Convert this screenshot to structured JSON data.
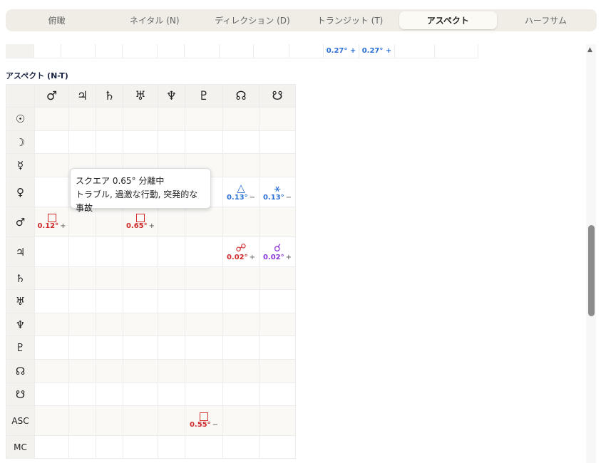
{
  "tabs": [
    {
      "label": "俯瞰",
      "active": false
    },
    {
      "label": "ネイタル (N)",
      "active": false
    },
    {
      "label": "ディレクション (D)",
      "active": false
    },
    {
      "label": "トランジット (T)",
      "active": false
    },
    {
      "label": "アスペクト",
      "active": true
    },
    {
      "label": "ハーフサム",
      "active": false
    }
  ],
  "top_row": {
    "cells": [
      "0.27° +",
      "0.27° +"
    ]
  },
  "section_title": "アスペクト (N-T)",
  "columns": [
    "♂",
    "♃",
    "♄",
    "♅",
    "♆",
    "♇",
    "☊",
    "☋"
  ],
  "rows": [
    {
      "label": "☉",
      "cells": [
        null,
        null,
        null,
        null,
        null,
        null,
        null,
        null
      ]
    },
    {
      "label": "☽",
      "cells": [
        null,
        null,
        null,
        null,
        null,
        null,
        null,
        null
      ]
    },
    {
      "label": "☿",
      "cells": [
        null,
        null,
        null,
        null,
        null,
        null,
        null,
        null
      ]
    },
    {
      "label": "♀",
      "cells": [
        null,
        null,
        null,
        null,
        null,
        null,
        {
          "symbol": "△",
          "value": "0.13°",
          "sign": "−",
          "color": "#2a6fd3",
          "name": "trine-icon"
        },
        {
          "symbol": "⚹",
          "value": "0.13°",
          "sign": "−",
          "color": "#2a6fd3",
          "name": "sextile-icon"
        }
      ]
    },
    {
      "label": "♂",
      "cells": [
        {
          "symbol": "□",
          "value": "0.12°",
          "sign": "+",
          "color": "#d02a2a",
          "name": "square-icon"
        },
        null,
        null,
        {
          "symbol": "□",
          "value": "0.65°",
          "sign": "+",
          "color": "#d02a2a",
          "name": "square-icon"
        },
        null,
        null,
        null,
        null
      ]
    },
    {
      "label": "♃",
      "cells": [
        null,
        null,
        null,
        null,
        null,
        null,
        {
          "symbol": "☍",
          "value": "0.02°",
          "sign": "+",
          "color": "#d02a2a",
          "name": "opposition-icon"
        },
        {
          "symbol": "☌",
          "value": "0.02°",
          "sign": "+",
          "color": "#8a35d8",
          "name": "conjunction-icon"
        }
      ]
    },
    {
      "label": "♄",
      "cells": [
        null,
        null,
        null,
        null,
        null,
        null,
        null,
        null
      ]
    },
    {
      "label": "♅",
      "cells": [
        null,
        null,
        null,
        null,
        null,
        null,
        null,
        null
      ]
    },
    {
      "label": "♆",
      "cells": [
        null,
        null,
        null,
        null,
        null,
        null,
        null,
        null
      ]
    },
    {
      "label": "♇",
      "cells": [
        null,
        null,
        null,
        null,
        null,
        null,
        null,
        null
      ]
    },
    {
      "label": "☊",
      "cells": [
        null,
        null,
        null,
        null,
        null,
        null,
        null,
        null
      ]
    },
    {
      "label": "☋",
      "cells": [
        null,
        null,
        null,
        null,
        null,
        null,
        null,
        null
      ]
    },
    {
      "label": "ASC",
      "cells": [
        null,
        null,
        null,
        null,
        null,
        {
          "symbol": "□",
          "value": "0.55°",
          "sign": "−",
          "color": "#d02a2a",
          "name": "square-icon"
        },
        null,
        null
      ]
    },
    {
      "label": "MC",
      "cells": [
        null,
        null,
        null,
        null,
        null,
        null,
        null,
        null
      ]
    }
  ],
  "tooltip": {
    "line1": "スクエア 0.65° 分離中",
    "line2": "トラブル, 過激な行動, 突発的な事故"
  },
  "scroll_up_glyph": "▲"
}
